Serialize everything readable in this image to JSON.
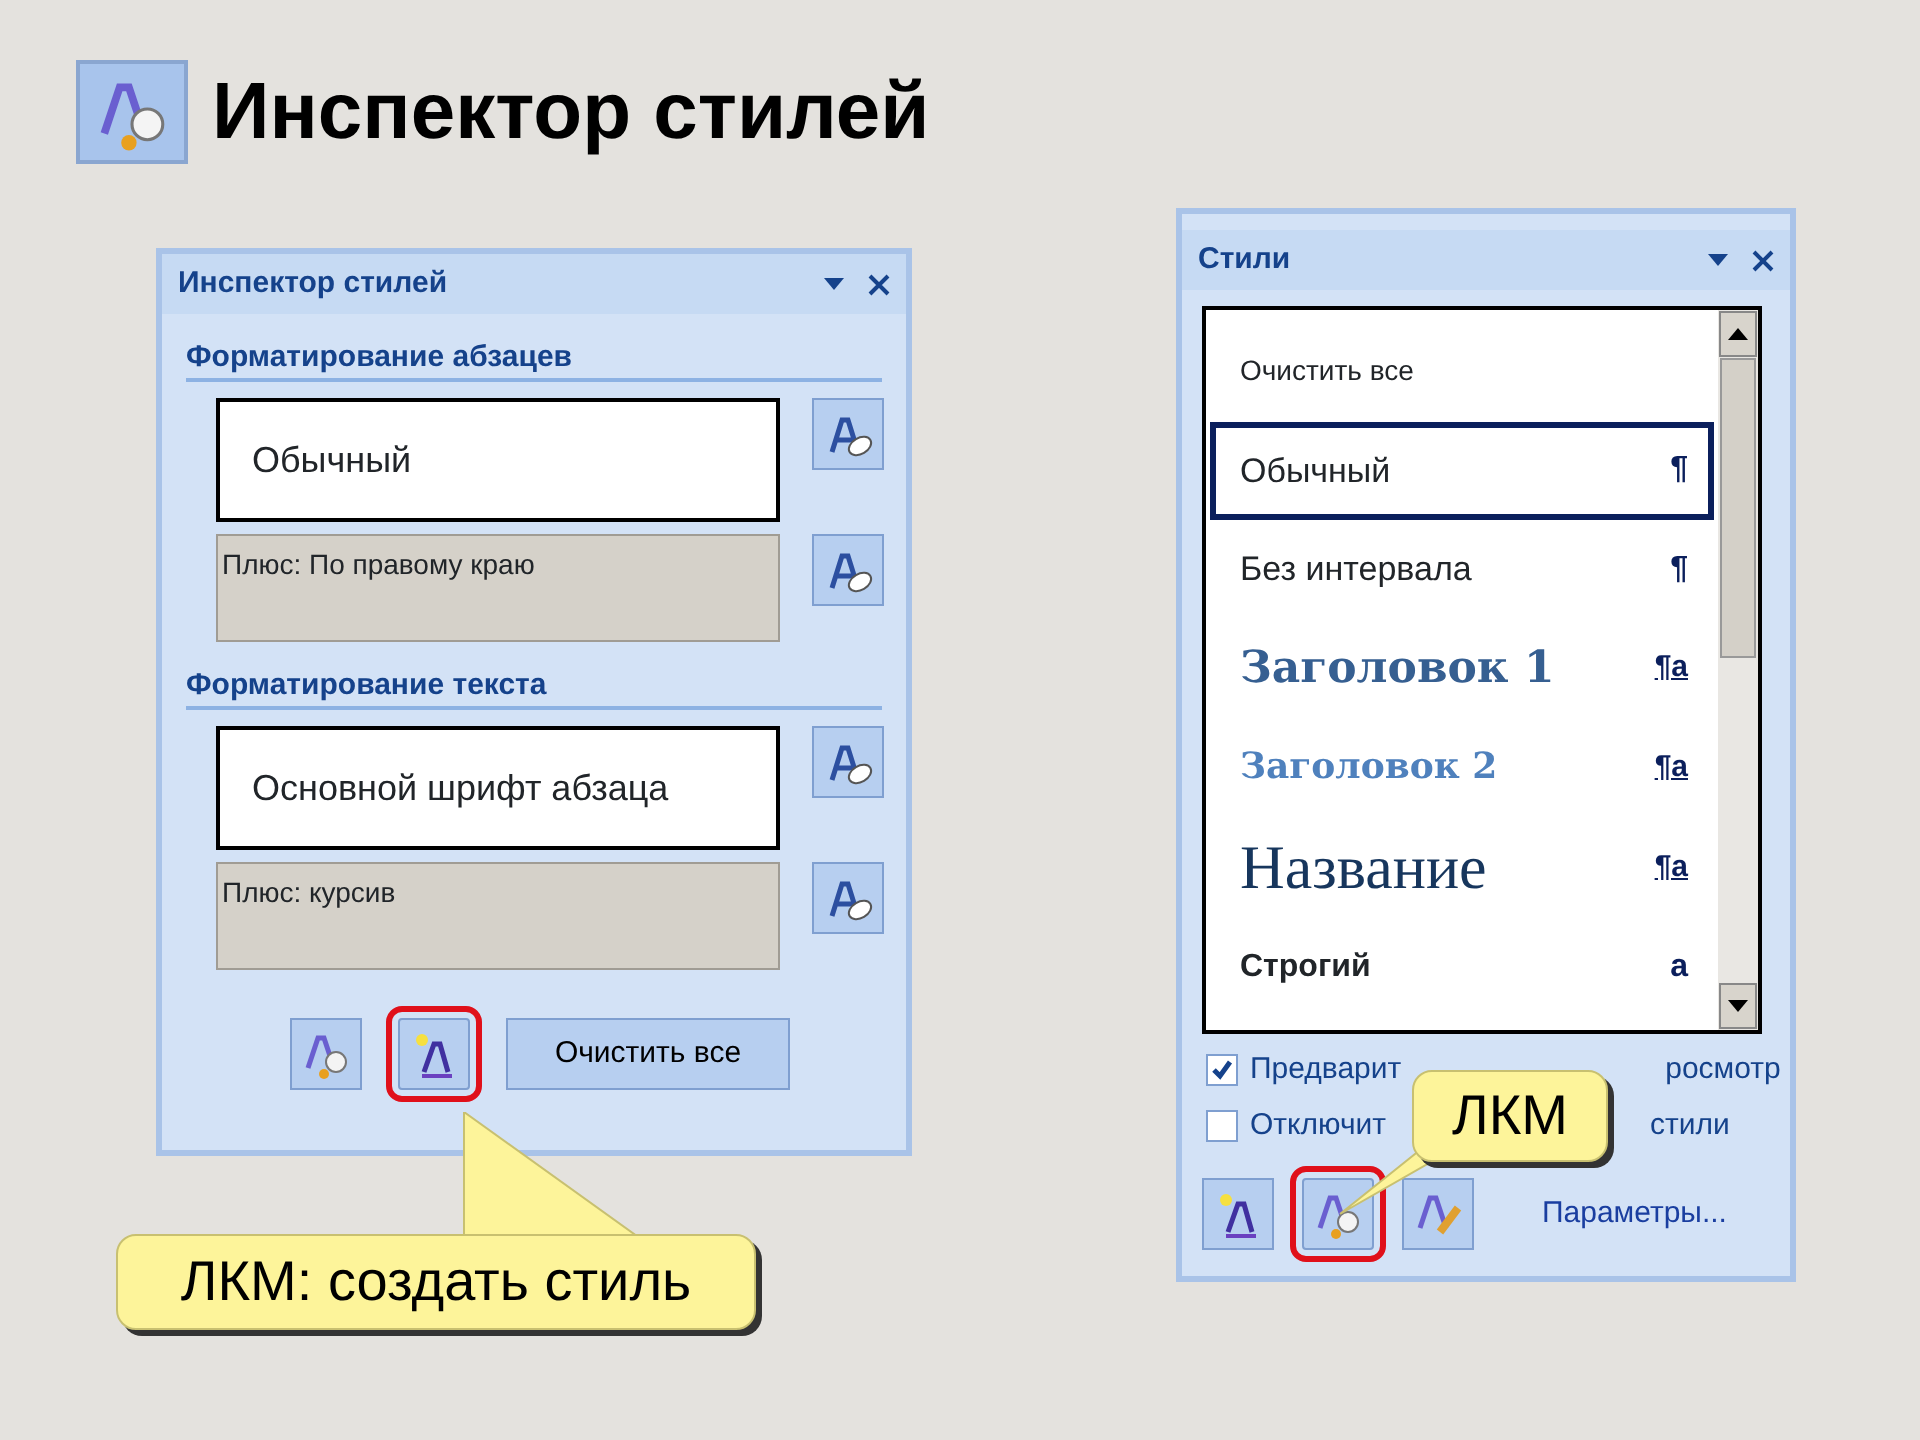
{
  "title": {
    "text": "Инспектор стилей"
  },
  "inspector_pane": {
    "title": "Инспектор стилей",
    "sections": [
      {
        "heading": "Форматирование абзацев",
        "style": "Обычный",
        "extra": "Плюс: По правому краю"
      },
      {
        "heading": "Форматирование текста",
        "style": "Основной шрифт абзаца",
        "extra": "Плюс: курсив"
      }
    ],
    "tool_buttons": [
      {
        "kind": "inspect",
        "highlighted": false
      },
      {
        "kind": "new-style",
        "highlighted": true
      }
    ],
    "clear_button": "Очистить все"
  },
  "styles_pane": {
    "title": "Стили",
    "items": [
      {
        "label": "Очистить все",
        "kind": "clear",
        "selected": false
      },
      {
        "label": "Обычный",
        "kind": "plain",
        "marker": "¶",
        "selected": true
      },
      {
        "label": "Без интервала",
        "kind": "plain",
        "marker": "¶",
        "selected": false
      },
      {
        "label": "Заголовок 1",
        "kind": "heading1",
        "marker": "¶a",
        "selected": false
      },
      {
        "label": "Заголовок 2",
        "kind": "heading2",
        "marker": "¶a",
        "selected": false
      },
      {
        "label": "Название",
        "kind": "title",
        "marker": "¶a",
        "selected": false
      },
      {
        "label": "Строгий",
        "kind": "strong",
        "marker": "a",
        "selected": false
      }
    ],
    "options": [
      {
        "parts": [
          "Предварит",
          "росмотр"
        ],
        "checked": true
      },
      {
        "parts": [
          "Отключит",
          "стили"
        ],
        "checked": false
      }
    ],
    "tool_buttons": [
      {
        "kind": "new-style",
        "highlighted": false
      },
      {
        "kind": "inspect",
        "highlighted": true
      },
      {
        "kind": "manage",
        "highlighted": false
      }
    ],
    "link": "Параметры..."
  },
  "callouts": [
    {
      "text": "ЛКМ: создать стиль"
    },
    {
      "text": "ЛКМ"
    }
  ]
}
